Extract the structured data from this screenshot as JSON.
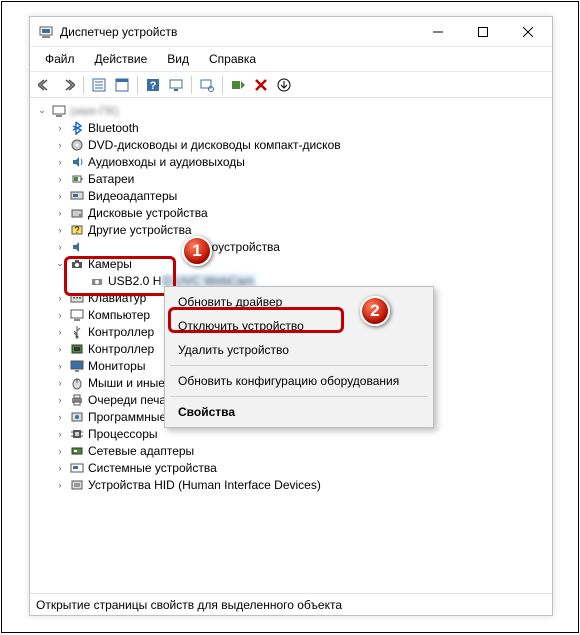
{
  "window": {
    "title": "Диспетчер устройств",
    "root_node": "(имя-ПК)"
  },
  "menubar": {
    "file": "Файл",
    "action": "Действие",
    "view": "Вид",
    "help": "Справка"
  },
  "tree": {
    "bluetooth": "Bluetooth",
    "dvd": "DVD-дисководы и дисководы компакт-дисков",
    "audio": "Аудиовходы и аудиовыходы",
    "battery": "Батареи",
    "video": "Видеоадаптеры",
    "disk": "Дисковые устройства",
    "other": "Другие устройства",
    "sound_video_hidden": "идеоустройства",
    "cameras": "Камеры",
    "camera_device": "USB2.0 H",
    "camera_device_tail": "D UVC WebCam",
    "keyboards": "Клавиатур",
    "computer": "Компьютер",
    "usb_controllers": "Контроллер",
    "storage_controllers": "Контроллер",
    "monitors": "Мониторы",
    "mice": "Мыши и иные указывающие устройства",
    "print_queues": "Очереди печати",
    "software": "Программные устройства",
    "processors": "Процессоры",
    "network": "Сетевые адаптеры",
    "system": "Системные устройства",
    "hid": "Устройства HID (Human Interface Devices)"
  },
  "context_menu": {
    "update_driver": "Обновить драйвер",
    "disable": "Отключить устройство",
    "remove": "Удалить устройство",
    "scan": "Обновить конфигурацию оборудования",
    "properties": "Свойства"
  },
  "statusbar": {
    "text": "Открытие страницы свойств для выделенного объекта"
  },
  "annotations": {
    "marker1": "1",
    "marker2": "2"
  }
}
